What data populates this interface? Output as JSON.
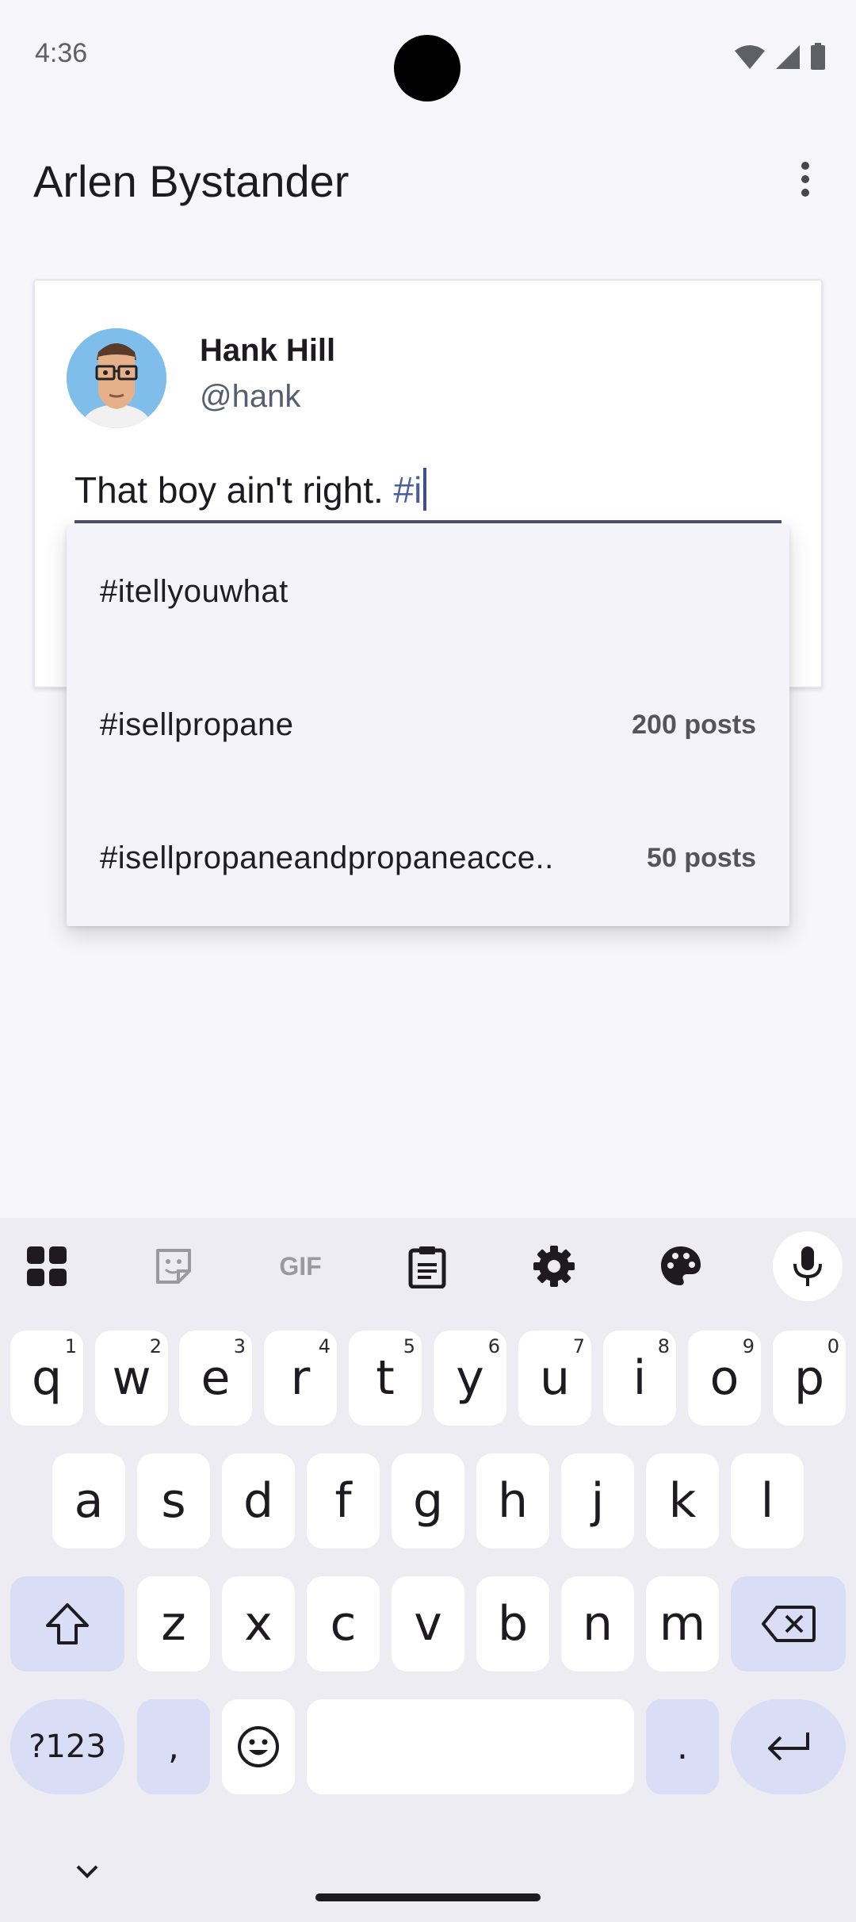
{
  "status_bar": {
    "time": "4:36"
  },
  "app_bar": {
    "title": "Arlen Bystander"
  },
  "post": {
    "author_name": "Hank Hill",
    "author_handle": "@hank",
    "compose_text": "That boy ain't right. ",
    "compose_hashtag": "#i"
  },
  "suggestions": [
    {
      "tag": "#itellyouwhat",
      "count": ""
    },
    {
      "tag": "#isellpropane",
      "count": "200 posts"
    },
    {
      "tag": "#isellpropaneandpropaneacce..",
      "count": "50 posts"
    }
  ],
  "keyboard": {
    "toolbar": [
      "apps-icon",
      "sticker-icon",
      "gif-icon",
      "clipboard-icon",
      "settings-icon",
      "theme-palette-icon",
      "microphone-icon"
    ],
    "gif_label": "GIF",
    "row1": [
      {
        "label": "q",
        "hint": "1"
      },
      {
        "label": "w",
        "hint": "2"
      },
      {
        "label": "e",
        "hint": "3"
      },
      {
        "label": "r",
        "hint": "4"
      },
      {
        "label": "t",
        "hint": "5"
      },
      {
        "label": "y",
        "hint": "6"
      },
      {
        "label": "u",
        "hint": "7"
      },
      {
        "label": "i",
        "hint": "8"
      },
      {
        "label": "o",
        "hint": "9"
      },
      {
        "label": "p",
        "hint": "0"
      }
    ],
    "row2": [
      "a",
      "s",
      "d",
      "f",
      "g",
      "h",
      "j",
      "k",
      "l"
    ],
    "row3": [
      "z",
      "x",
      "c",
      "v",
      "b",
      "n",
      "m"
    ],
    "symbols_label": "?123",
    "comma_label": ",",
    "period_label": "."
  },
  "colors": {
    "accent": "#4c5d9c",
    "keyboard_bg": "#edecf3",
    "modifier_key": "#d9ddf5"
  }
}
